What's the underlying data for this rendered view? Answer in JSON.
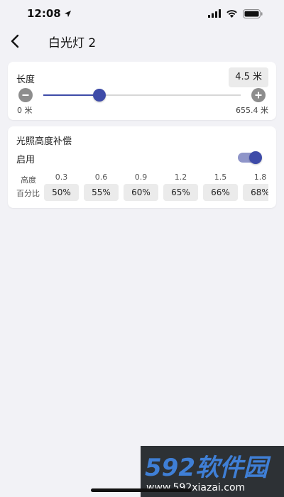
{
  "status_bar": {
    "time": "12:08",
    "icons": [
      "location-arrow-icon",
      "signal-icon",
      "wifi-icon",
      "battery-icon"
    ]
  },
  "header": {
    "back_icon": "chevron-left-icon",
    "title": "白光灯 2"
  },
  "length": {
    "label": "长度",
    "value": "4.5 米",
    "min_label": "0 米",
    "max_label": "655.4 米",
    "slider_fraction": 0.285
  },
  "compensation": {
    "title": "光照高度补偿",
    "enable_label": "启用",
    "enabled": true,
    "height_row_label": "高度",
    "percent_row_label": "百分比",
    "columns": [
      {
        "height": "0.3",
        "percent": "50%"
      },
      {
        "height": "0.6",
        "percent": "55%"
      },
      {
        "height": "0.9",
        "percent": "60%"
      },
      {
        "height": "1.2",
        "percent": "65%"
      },
      {
        "height": "1.5",
        "percent": "66%"
      },
      {
        "height": "1.8",
        "percent": "68%"
      }
    ]
  },
  "watermark": {
    "brand": "592软件园",
    "url": "www.592xiazai.com"
  },
  "colors": {
    "accent": "#3e4ba8",
    "accent_light": "#8f95c9",
    "background": "#f2f2f6",
    "card": "#ffffff",
    "chip": "#ebebeb"
  }
}
